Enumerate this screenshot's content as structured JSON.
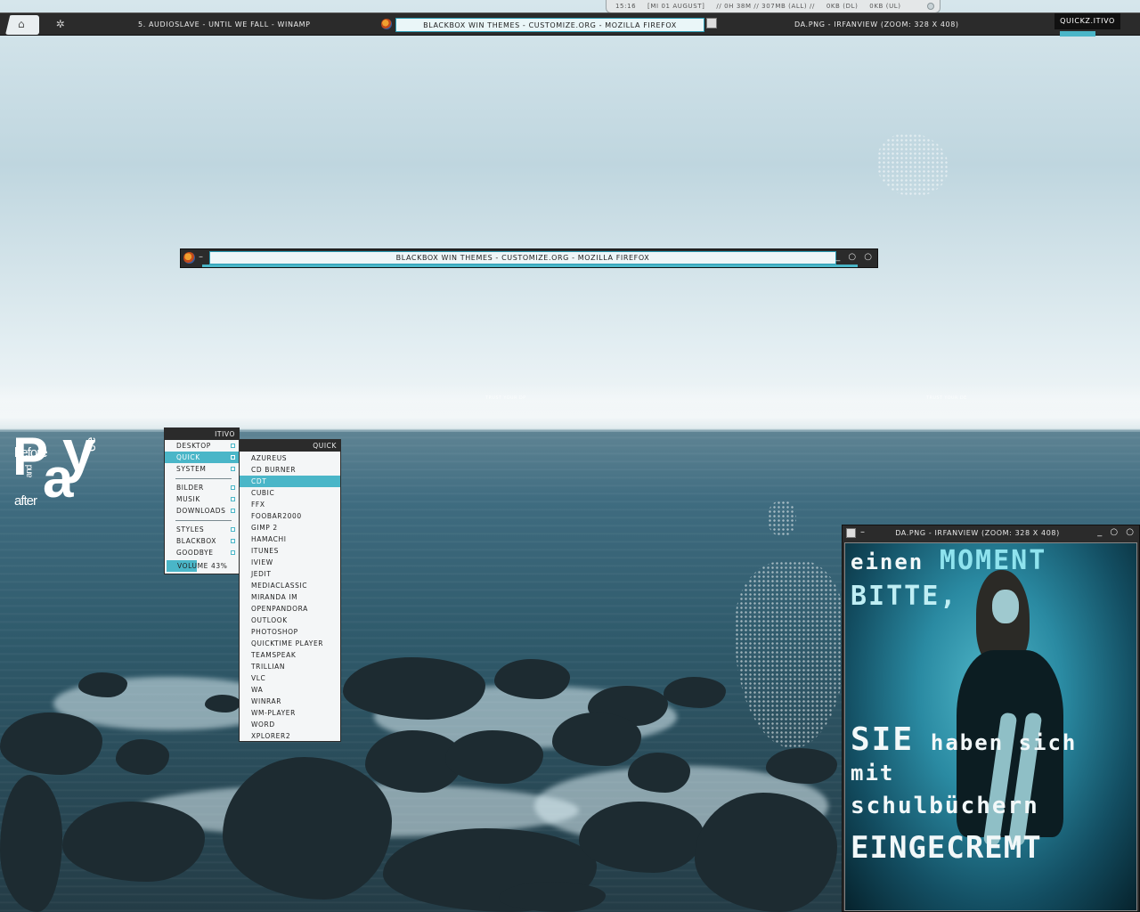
{
  "status_bar": {
    "time": "15:16",
    "date": "[MI 01 AUGUST]",
    "uptime": "// 0H 38M // 307MB (ALL) //",
    "download": "0KB (DL)",
    "upload": "0KB (UL)"
  },
  "toolbar": {
    "tasks": [
      "5. Audioslave - Until We Fall - Winamp",
      "BlackBox Win Themes - customize.org - Mozilla Firefox",
      "da.png - IrfanView (Zoom: 328 x 408)"
    ],
    "workspace_label": "QUICKZ.ITIVO"
  },
  "firefox_window": {
    "title": "BlackBox Win Themes - customize.org - Mozilla Firefox",
    "buttons": "_ ○ ○"
  },
  "root_menu": {
    "title": "ITIVO",
    "items": [
      "DESKTOP",
      "QUICK",
      "SYSTEM",
      "BILDER",
      "MUSIK",
      "DOWNLOADS",
      "STYLES",
      "BLACKBOX",
      "GOODBYE"
    ],
    "volume_label": "VOLUME 43%",
    "volume": 0.43
  },
  "quick_menu": {
    "title": "QUICK",
    "items": [
      "AZUREUS",
      "CD BURNER",
      "CDT",
      "CUBIC",
      "FFX",
      "FOOBAR2000",
      "GIMP 2",
      "HAMACHI",
      "ITUNES",
      "IVIEW",
      "JEDIT",
      "MEDIACLASSIC",
      "MIRANDA IM",
      "OPENPANDORA",
      "OUTLOOK",
      "PHOTOSHOP",
      "QUICKTIME PLAYER",
      "TEAMSPEAK",
      "TRILLIAN",
      "VLC",
      "WA",
      "WINRAR",
      "WM-PLAYER",
      "WORD",
      "XPLORER2"
    ]
  },
  "irfanview_window": {
    "title": "da.png - IrfanView (Zoom: 328 x 408)",
    "buttons": "_ ○ ○",
    "image_text": {
      "line1a": "einen",
      "line1b": "MOMENT",
      "line2": "BITTE,",
      "line3a": "SIE",
      "line3b": "haben sich",
      "line4": "mit",
      "line5": "schulbüchern",
      "line6": "EINGECREMT"
    }
  },
  "logo": {
    "letters_1": "P",
    "letters_2": "a",
    "letters_3": "y",
    "word_before": "before",
    "word_and": "and",
    "word_after": "after",
    "word_ce": "ce"
  },
  "wallpaper_text": {
    "left": "TRUST YOUR DP",
    "right": "TRUST YOUR DE"
  },
  "colors": {
    "accent": "#4ab6c8",
    "bar_dark": "#2b2b2b",
    "menu_bg": "#f4f6f7"
  }
}
